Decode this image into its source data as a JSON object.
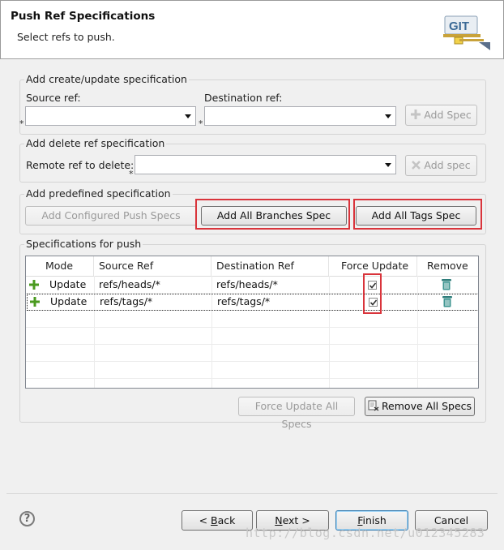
{
  "header": {
    "title": "Push Ref Specifications",
    "subtitle": "Select refs to push.",
    "logo_text": "GIT"
  },
  "create_group": {
    "label": "Add create/update specification",
    "source_label": "Source ref:",
    "destination_label": "Destination ref:",
    "source_value": "",
    "destination_value": "",
    "add_button": "Add Spec",
    "required_marker": "*"
  },
  "delete_group": {
    "label": "Add delete ref specification",
    "remote_label": "Remote ref to delete:",
    "remote_value": "",
    "add_button": "Add spec",
    "required_marker": "*"
  },
  "predefined_group": {
    "label": "Add predefined specification",
    "configured_button": "Add Configured Push Specs",
    "branches_button": "Add All Branches Spec",
    "tags_button": "Add All Tags Spec"
  },
  "specs_group": {
    "label": "Specifications for push",
    "columns": [
      "Mode",
      "Source Ref",
      "Destination Ref",
      "Force Update",
      "Remove"
    ],
    "rows": [
      {
        "mode": "Update",
        "source": "refs/heads/*",
        "destination": "refs/heads/*",
        "force": true
      },
      {
        "mode": "Update",
        "source": "refs/tags/*",
        "destination": "refs/tags/*",
        "force": true
      }
    ],
    "force_all_button": "Force Update All Specs",
    "remove_all_button": "Remove All Specs"
  },
  "footer": {
    "help": "?",
    "back_prefix": "< ",
    "back_key": "B",
    "back_rest": "ack",
    "next_key": "N",
    "next_rest": "ext >",
    "finish_key": "F",
    "finish_rest": "inish",
    "cancel": "Cancel"
  },
  "watermark": "http://blog.csdn.net/u012345283",
  "colors": {
    "highlight": "#d9343b",
    "plus_icon": "#4a9a1f",
    "trash_icon": "#2e7d7a"
  }
}
